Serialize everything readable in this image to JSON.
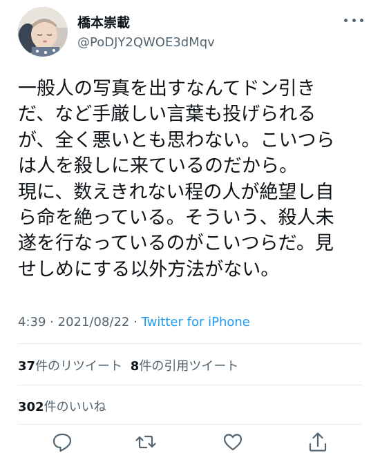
{
  "user": {
    "display_name": "橋本崇載",
    "handle": "@PoDJY2QWOE3dMqv",
    "avatar_icon": "baby-photo-avatar"
  },
  "tweet": {
    "lines": [
      "一般人の写真を出すなんてドン引き",
      "だ、など手厳しい言葉も投げられる",
      "が、全く悪いとも思わない。こいつら",
      "は人を殺しに来ているのだから。",
      "現に、数えきれない程の人が絶望し自",
      "ら命を絶っている。そういう、殺人未",
      "遂を行なっているのがこいつらだ。見",
      "せしめにする以外方法がない。"
    ]
  },
  "meta": {
    "time": "4:39",
    "separator": "·",
    "date": "2021/08/22",
    "source": "Twitter for iPhone"
  },
  "stats": {
    "retweets_count": "37",
    "retweets_label": "件のリツイート",
    "quotes_count": "8",
    "quotes_label": "件の引用ツイート",
    "likes_count": "302",
    "likes_label": "件のいいね"
  },
  "actions": {
    "reply_icon": "reply-icon",
    "retweet_icon": "retweet-icon",
    "like_icon": "heart-icon",
    "share_icon": "share-icon"
  },
  "colors": {
    "text": "#0f1419",
    "secondary": "#536471",
    "link": "#1d9bf0",
    "divider": "#e6ecf0"
  }
}
